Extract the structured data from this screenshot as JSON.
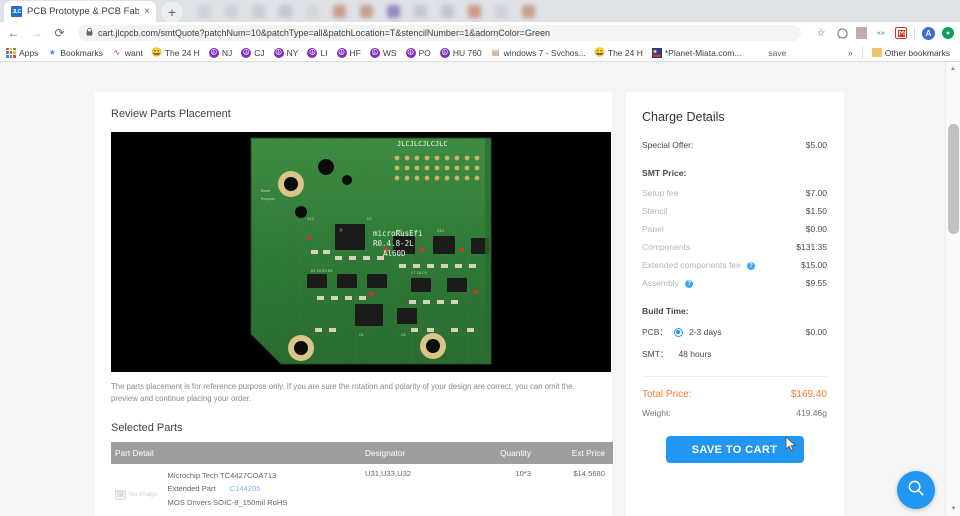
{
  "browser": {
    "tab": {
      "title": "PCB Prototype & PCB Fabrication",
      "favicon_text": "JLC",
      "close_icon": "×"
    },
    "new_tab_icon": "+",
    "nav": {
      "back_icon": "←",
      "forward_icon": "→",
      "reload_icon": "⟳"
    },
    "omnibox": {
      "lock_icon": "🔒",
      "url": "cart.jlcpcb.com/smtQuote?patchNum=10&patchType=all&patchLocation=T&stencilNumber=1&adornColor=Green"
    },
    "toolbar_icons": {
      "bookmark_star": "☆",
      "circle": "○",
      "pdf": "",
      "extension": "«»",
      "app": "",
      "avatar": "A",
      "green": "✛"
    },
    "bookmarks": {
      "items": [
        {
          "label": "Apps",
          "icon": "apps-grid-icon"
        },
        {
          "label": "Bookmarks",
          "icon": "star-icon"
        },
        {
          "label": "want",
          "icon": "scribble-icon"
        },
        {
          "label": "The 24 H",
          "icon": "emoji-icon"
        },
        {
          "label": "NJ",
          "icon": "peace-icon"
        },
        {
          "label": "CJ",
          "icon": "peace-icon"
        },
        {
          "label": "NY",
          "icon": "peace-icon"
        },
        {
          "label": "LI",
          "icon": "peace-icon"
        },
        {
          "label": "HF",
          "icon": "peace-icon"
        },
        {
          "label": "WS",
          "icon": "peace-icon"
        },
        {
          "label": "PO",
          "icon": "peace-icon"
        },
        {
          "label": "HU 760",
          "icon": "peace-icon"
        },
        {
          "label": "windows 7 - Svchos...",
          "icon": "page-icon"
        },
        {
          "label": "The 24 H",
          "icon": "emoji-icon"
        },
        {
          "label": "*Planet-Miata.com...",
          "icon": "miata-icon"
        },
        {
          "label": "save",
          "icon": "none"
        }
      ],
      "overflow_icon": "»",
      "other_bookmarks": "Other bookmarks"
    }
  },
  "main": {
    "title": "Review Parts Placement",
    "pcb_silkscreen": [
      "microRusEfi",
      "R0.4.8-2L",
      "Al60D",
      "JLCJLCJLCJLC"
    ],
    "note": "The parts placement is for reference purpose only. If you are sure the rotation and polarity of your design are correct, you can omit the preview and continue placing your order.",
    "selected_parts_title": "Selected Parts",
    "table": {
      "headers": [
        "Part Detail",
        "Designator",
        "Quantity",
        "Ext Price"
      ],
      "rows": [
        {
          "image_placeholder": "No-Image",
          "name": "Microchip Tech TC4427COA713",
          "type_label": "Extended Part",
          "part_code": "C144205",
          "description": "MOS Drivers SOIC-8_150mil RoHS",
          "designator": "U31,U33,U32",
          "quantity": "10*3",
          "ext_price": "$14.5680"
        }
      ]
    }
  },
  "charge": {
    "title": "Charge Details",
    "special_offer": {
      "label": "Special Offer:",
      "value": "$5.00"
    },
    "smt_price_title": "SMT Price:",
    "smt_items": [
      {
        "label": "Setup fee",
        "value": "$7.00",
        "help": false
      },
      {
        "label": "Stencil",
        "value": "$1.50",
        "help": false
      },
      {
        "label": "Panel",
        "value": "$0.00",
        "help": false
      },
      {
        "label": "Components",
        "value": "$131.35",
        "help": false
      },
      {
        "label": "Extended components fee",
        "value": "$15.00",
        "help": true
      },
      {
        "label": "Assembly",
        "value": "$9.55",
        "help": true
      }
    ],
    "build_time_title": "Build Time:",
    "pcb_row": {
      "label": "PCB：",
      "option": "2-3 days",
      "value": "$0.00",
      "selected": true
    },
    "smt_row": {
      "label": "SMT：",
      "option": "48 hours"
    },
    "total": {
      "label": "Total Price:",
      "value": "$169.40"
    },
    "weight": {
      "label": "Weight:",
      "value": "419.46g"
    },
    "save_button": "SAVE TO CART"
  },
  "fab": {
    "icon": "search-icon"
  }
}
